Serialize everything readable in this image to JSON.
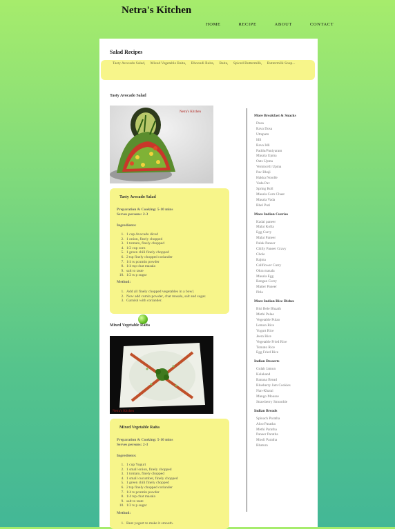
{
  "site": {
    "title": "Netra's Kitchen"
  },
  "nav": [
    "HOME",
    "RECIPE",
    "ABOUT",
    "CONTACT"
  ],
  "page": {
    "title": "Salad Recipes",
    "links": [
      "Tasty Avocado Salad,",
      "Mixed Vegetable Raita,",
      "Bhoondi Raita,",
      "Raita,",
      "Spiced Buttermilk,",
      "Buttermilk Soup..."
    ]
  },
  "recipes": [
    {
      "title": "Tasty Avocado Salad",
      "photo_watermark": "Netra's Kitchen",
      "card_title": "Tasty Avocado Salad",
      "prep": "Preparation & Cooking: 5-10 mins",
      "serves": "Serves persons: 2-3",
      "ingredients_label": "Ingredients:",
      "ingredients": [
        "1 cup Avocado diced",
        "1 onion, finely chopped",
        "1 tomato, finely chopped",
        "1/2 cup corn",
        "1 green chili finely chopped",
        "2 tsp finely chopped coriander",
        "1/4 ts pcumin powder",
        "1/4 tsp chat masala",
        "salt to taste",
        "1/2 ts p sugar"
      ],
      "method_label": "Method:",
      "method": [
        "Add all finely chopped vegetables in a bowl.",
        "Now add cumin powder, chat masala, salt and sugar.",
        "Garnish with coriander."
      ]
    },
    {
      "title": "Mixed Vegetable Raita",
      "photo_watermark": "Netra's Kitchen",
      "card_title": "Mixed Vegetable Raita",
      "prep": "Preparation & Cooking: 5-10 mins",
      "serves": "Serves persons: 2-3",
      "ingredients_label": "Ingredients:",
      "ingredients": [
        "1 cup Yogurt",
        "1 small onion, finely chopped",
        "1 tomato, finely chopped",
        "1 small cucumber, finely chopped",
        "1 green chili finely chopped",
        "2 tsp finely chopped coriander",
        "1/4 ts pcumin powder",
        "1/4 tsp chat masala",
        "salt to taste",
        "1/2 ts p sugar"
      ],
      "method_label": "Method:",
      "method": [
        "Beat yogurt to make it smooth."
      ]
    }
  ],
  "sidebar": [
    {
      "heading": "More Breakfast & Snacks",
      "items": [
        "Dosa",
        "Rava Dosa",
        "Uttapam",
        "Idli",
        "Rava Idli",
        "Paddu/Paniyaram",
        "Masala Upma",
        "Oats Upma",
        "Vermicelli Upma",
        "Pav Bhaji",
        "Hakka Noodle",
        "Vada Pav",
        "Spring Roll",
        "Masala Corn Chaat",
        "Masala Vada",
        "Bhel Puri"
      ]
    },
    {
      "heading": "More Indian Curries",
      "items": [
        "Kadai paneer",
        "Malai Kofta",
        "Egg Curry",
        "Malai Paneer",
        "Palak Paneer",
        "Chilly Paneer Gravy",
        "Chole",
        "Rajma",
        "Califlower Curry",
        "Okra masala",
        "Masala Egg",
        "Bengan Curry",
        "Matter Paneer",
        "Pitla"
      ]
    },
    {
      "heading": "More Indian Rice Dishes",
      "items": [
        "Bisi Bele Bhaath",
        "Methi Pulao",
        "Vegetable Pulao",
        "Lemon Rice",
        "Yogurt Rice",
        "Jeera Rice",
        "Vegetable Fried Rice",
        "Tomato Rice",
        "Egg Fried Rice"
      ]
    },
    {
      "heading": "Indian Desserts",
      "items": [
        "Gulab Jamun",
        "Kalakand",
        "Banana Bread",
        "Blueberry Jam Cookies",
        "Nan-Khatai",
        "Mango Mousse",
        "Strawberry Smoothie"
      ]
    },
    {
      "heading": "Indian Breads",
      "items": [
        "Spinach Paratha",
        "Aloo Paratha",
        "Methi Paratha",
        "Paneer Paratha",
        "Mooli Paratha",
        "Bhatura"
      ]
    }
  ]
}
